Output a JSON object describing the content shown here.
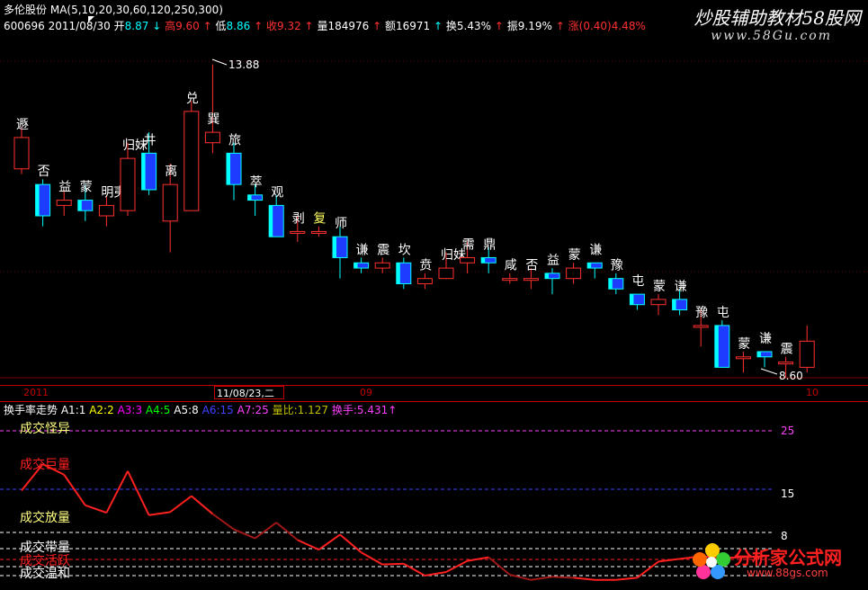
{
  "header": {
    "stock_name": "多伦股份",
    "ma_label": "MA(5,10,20,30,60,120,250,300)",
    "code_date": "600696 2011/08/30",
    "open_label": "开",
    "open_value": "8.87",
    "high_label": "高",
    "high_value": "9.60",
    "low_label": "低",
    "low_value": "8.86",
    "close_label": "收",
    "close_value": "9.32",
    "volume_label": "量",
    "volume_value": "184976",
    "amount_label": "额",
    "amount_value": "16971",
    "turnover_label": "换",
    "turnover_value": "5.43%",
    "amplitude_label": "振",
    "amplitude_value": "9.19%",
    "change_label": "涨",
    "change_value": "(0.40)",
    "change_pct": "4.48%",
    "colors": {
      "up": "#ff3030",
      "down": "#00ffff",
      "neutral": "#ffffff"
    }
  },
  "watermark": {
    "title": "炒股辅助教材58股网",
    "url": "www.58Gu.com"
  },
  "price_marks": {
    "high": "13.88",
    "low": "8.60"
  },
  "gua_labels": [
    "遯",
    "否",
    "益",
    "蒙",
    "明夷",
    "归妹",
    "井",
    "离",
    "兑",
    "巽",
    "旅",
    "萃",
    "观",
    "剥",
    "复",
    "师",
    "谦",
    "震",
    "坎",
    "贲",
    "归妹",
    "需",
    "鼎",
    "咸",
    "否",
    "益",
    "蒙",
    "谦",
    "豫",
    "屯",
    "蒙",
    "谦",
    "豫",
    "屯",
    "蒙",
    "谦",
    "震"
  ],
  "date_axis": {
    "labels": [
      "2011",
      "09",
      "10"
    ],
    "highlight": "11/08/23,二"
  },
  "lower_header": {
    "title": "换手率走势",
    "a1": "A1:1",
    "a2": "A2:2",
    "a3": "A3:3",
    "a4": "A4:5",
    "a5": "A5:8",
    "a6": "A6:15",
    "a7": "A7:25",
    "liangbi": "量比:1.127",
    "huanshou": "换手:5.431",
    "colors": {
      "a1": "#ffffff",
      "a2": "#ffff00",
      "a3": "#ff00ff",
      "a4": "#00ff00",
      "a5": "#ffffff",
      "a6": "#4040ff",
      "a7": "#ff40ff",
      "liangbi": "#c0c000",
      "huanshou": "#ff40ff"
    }
  },
  "levels": [
    {
      "label": "成交怪异",
      "color": "#ffff80"
    },
    {
      "label": "成交巨量",
      "color": "#ff2020"
    },
    {
      "label": "成交放量",
      "color": "#ffff80"
    },
    {
      "label": "成交带量",
      "color": "#ffffff"
    },
    {
      "label": "成交活跃",
      "color": "#ff2020"
    },
    {
      "label": "成交温和",
      "color": "#ffffff"
    }
  ],
  "scale_labels": {
    "v25": "25",
    "v15": "15",
    "v8": "8"
  },
  "logo": {
    "text": "分析家公式网",
    "url": "www.88gs.com"
  },
  "chart_data": {
    "type": "line",
    "title": "换手率走势",
    "reference_lines": [
      1,
      2,
      3,
      5,
      8,
      15,
      25
    ],
    "series": [
      {
        "name": "换手",
        "values": [
          14.8,
          19.3,
          17.5,
          12.4,
          11.2,
          18.1,
          10.8,
          11.3,
          13.9,
          11.0,
          8.5,
          6.9,
          9.6,
          6.6,
          4.8,
          7.6,
          4.3,
          2.3,
          2.4,
          1.0,
          1.4,
          2.8,
          3.4,
          1.1,
          0.6,
          0.9,
          0.8,
          0.6,
          0.6,
          0.8,
          2.7,
          3.1,
          3.6,
          3.3,
          3.4,
          3.6
        ]
      }
    ]
  },
  "candles": [
    {
      "o": 11.9,
      "c": 12.5,
      "h": 12.7,
      "l": 11.8
    },
    {
      "o": 11.6,
      "c": 11.0,
      "h": 11.7,
      "l": 10.8
    },
    {
      "o": 11.2,
      "c": 11.3,
      "h": 11.5,
      "l": 11.0
    },
    {
      "o": 11.3,
      "c": 11.1,
      "h": 11.6,
      "l": 10.9
    },
    {
      "o": 11.0,
      "c": 11.2,
      "h": 11.4,
      "l": 10.8
    },
    {
      "o": 11.1,
      "c": 12.1,
      "h": 12.4,
      "l": 11.0
    },
    {
      "o": 12.2,
      "c": 11.5,
      "h": 12.6,
      "l": 11.4
    },
    {
      "o": 10.9,
      "c": 11.6,
      "h": 12.0,
      "l": 10.3
    },
    {
      "o": 11.1,
      "c": 13.0,
      "h": 13.2,
      "l": 11.1
    },
    {
      "o": 12.4,
      "c": 12.6,
      "h": 13.9,
      "l": 12.2
    },
    {
      "o": 12.2,
      "c": 11.6,
      "h": 12.4,
      "l": 11.3
    },
    {
      "o": 11.4,
      "c": 11.3,
      "h": 11.6,
      "l": 11.0
    },
    {
      "o": 11.2,
      "c": 10.6,
      "h": 11.4,
      "l": 10.6
    },
    {
      "o": 10.7,
      "c": 10.7,
      "h": 11.0,
      "l": 10.5
    },
    {
      "o": 10.7,
      "c": 10.7,
      "h": 10.8,
      "l": 10.6
    },
    {
      "o": 10.6,
      "c": 10.2,
      "h": 10.8,
      "l": 9.8
    },
    {
      "o": 10.1,
      "c": 10.0,
      "h": 10.2,
      "l": 9.9
    },
    {
      "o": 10.0,
      "c": 10.1,
      "h": 10.2,
      "l": 9.9
    },
    {
      "o": 10.1,
      "c": 9.7,
      "h": 10.2,
      "l": 9.6
    },
    {
      "o": 9.7,
      "c": 9.8,
      "h": 9.9,
      "l": 9.6
    },
    {
      "o": 9.8,
      "c": 10.0,
      "h": 10.3,
      "l": 9.8
    },
    {
      "o": 10.1,
      "c": 10.2,
      "h": 10.5,
      "l": 9.9
    },
    {
      "o": 10.2,
      "c": 10.1,
      "h": 10.4,
      "l": 9.9
    },
    {
      "o": 9.8,
      "c": 9.8,
      "h": 9.9,
      "l": 9.7
    },
    {
      "o": 9.8,
      "c": 9.8,
      "h": 10.0,
      "l": 9.6
    },
    {
      "o": 9.9,
      "c": 9.8,
      "h": 10.0,
      "l": 9.5
    },
    {
      "o": 9.8,
      "c": 10.0,
      "h": 10.1,
      "l": 9.7
    },
    {
      "o": 10.1,
      "c": 10.0,
      "h": 10.1,
      "l": 9.8
    },
    {
      "o": 9.8,
      "c": 9.6,
      "h": 9.9,
      "l": 9.5
    },
    {
      "o": 9.5,
      "c": 9.3,
      "h": 9.5,
      "l": 9.2
    },
    {
      "o": 9.3,
      "c": 9.4,
      "h": 9.5,
      "l": 9.1
    },
    {
      "o": 9.4,
      "c": 9.2,
      "h": 9.6,
      "l": 9.1
    },
    {
      "o": 8.9,
      "c": 8.9,
      "h": 9.2,
      "l": 8.5
    },
    {
      "o": 8.9,
      "c": 8.1,
      "h": 9.0,
      "l": 8.1
    },
    {
      "o": 8.3,
      "c": 8.3,
      "h": 8.4,
      "l": 8.0
    },
    {
      "o": 8.4,
      "c": 8.3,
      "h": 8.4,
      "l": 8.1
    },
    {
      "o": 8.2,
      "c": 8.2,
      "h": 8.3,
      "l": 7.9
    },
    {
      "o": 8.1,
      "c": 8.6,
      "h": 8.9,
      "l": 8.0
    }
  ]
}
